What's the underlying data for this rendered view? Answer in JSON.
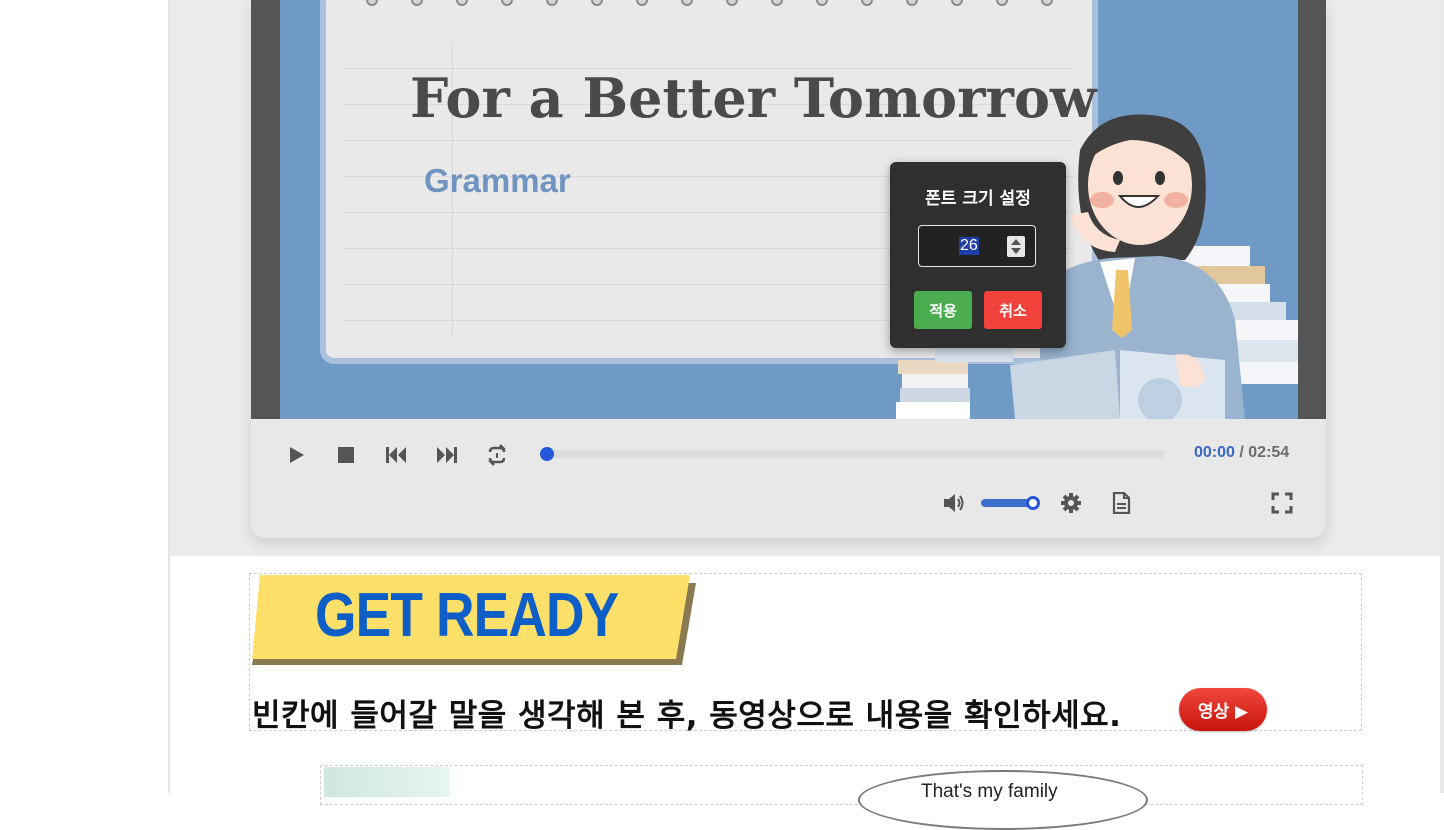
{
  "video": {
    "title": "For a Better Tomorrow",
    "subtitle": "Grammar"
  },
  "player": {
    "current_time": "00:00",
    "separator": " / ",
    "duration": "02:54",
    "progress": 0.0,
    "volume": 0.85,
    "icons": [
      "play-icon",
      "stop-icon",
      "previous-icon",
      "next-icon",
      "repeat-icon",
      "volume-icon",
      "settings-icon",
      "document-icon",
      "fullscreen-icon"
    ]
  },
  "font_popup": {
    "title": "폰트 크기 설정",
    "value": "26",
    "apply_label": "적용",
    "cancel_label": "취소"
  },
  "section": {
    "banner": "GET READY",
    "instruction": "빈칸에 들어갈 말을 생각해 본 후, 동영상으로 내용을 확인하세요.",
    "video_button": "영상 ▶"
  },
  "lower": {
    "bubble_text": "That's my family"
  },
  "colors": {
    "accent_blue": "#2457d9",
    "apply_green": "#4cad50",
    "cancel_red": "#f0413a",
    "banner_yellow": "#fde06a",
    "banner_blue": "#0d5ec7"
  }
}
